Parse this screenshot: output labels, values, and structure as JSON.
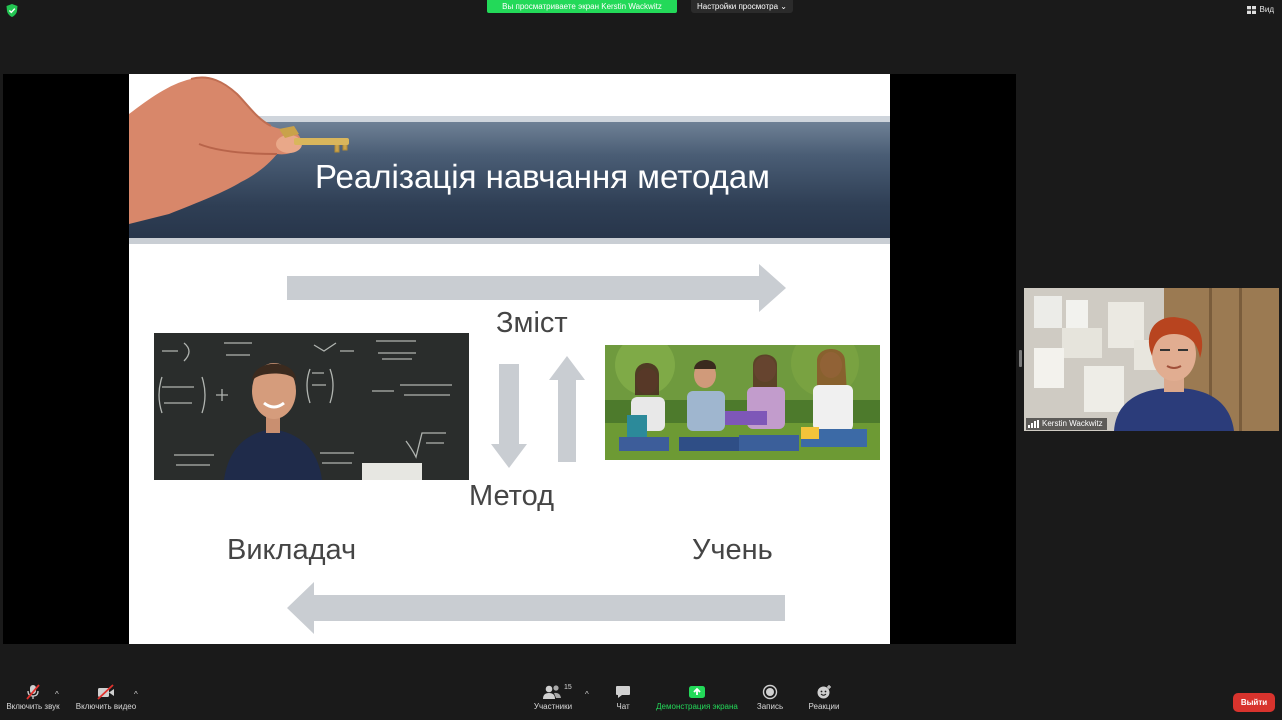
{
  "top_bar": {
    "share_banner": "Вы просматриваете экран Kerstin Wackwitz",
    "view_options": "Настройки просмотра",
    "view_button": "Вид"
  },
  "slide": {
    "title": "Реалізація навчання методам",
    "label_content": "Зміст",
    "label_method": "Метод",
    "label_teacher": "Викладач",
    "label_student": "Учень"
  },
  "participant": {
    "name": "Kerstin Wackwitz"
  },
  "toolbar": {
    "mute": "Включить звук",
    "video": "Включить видео",
    "participants": "Участники",
    "participants_count": "15",
    "chat": "Чат",
    "share": "Демонстрация экрана",
    "record": "Запись",
    "reactions": "Реакции",
    "leave": "Выйти"
  },
  "colors": {
    "share_green": "#23d959",
    "leave_red": "#d8332d",
    "toolbar_bg": "#1a1a1a",
    "slide_band": "#2f3f55"
  }
}
